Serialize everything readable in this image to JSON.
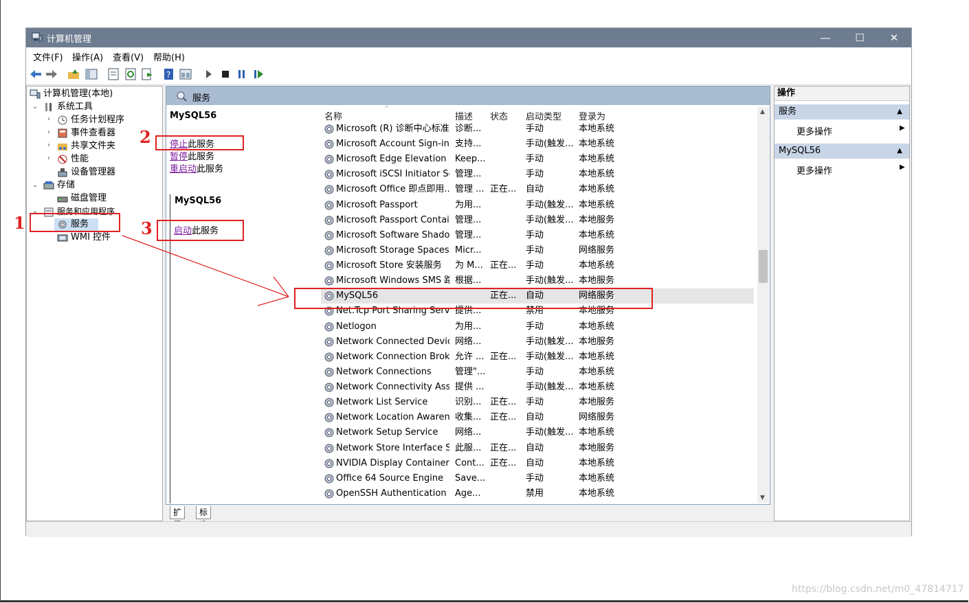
{
  "window": {
    "title": "计算机管理",
    "controls": [
      "—",
      "☐",
      "✕"
    ]
  },
  "menu": [
    "文件(F)",
    "操作(A)",
    "查看(V)",
    "帮助(H)"
  ],
  "tree": {
    "root": "计算机管理(本地)",
    "system_tools": "系统工具",
    "task_scheduler": "任务计划程序",
    "event_viewer": "事件查看器",
    "shared_folders": "共享文件夹",
    "performance": "性能",
    "device_manager": "设备管理器",
    "storage": "存储",
    "disk_management": "磁盘管理",
    "services_apps": "服务和应用程序",
    "services": "服务",
    "wmi": "WMI 控件"
  },
  "center": {
    "header": "服务",
    "selected_name": "MySQL56",
    "actions": {
      "stop_link": "停止",
      "stop_rest": "此服务",
      "pause_link": "暂停",
      "pause_rest": "此服务",
      "restart_link": "重启动",
      "restart_rest": "此服务"
    },
    "overlay_name": "MySQL56",
    "start_link": "启动",
    "start_rest": "此服务"
  },
  "columns": {
    "name": "名称",
    "desc": "描述",
    "status": "状态",
    "startup": "启动类型",
    "logon": "登录为"
  },
  "rows": [
    {
      "name": "Microsoft (R) 诊断中心标准...",
      "desc": "诊断...",
      "status": "",
      "startup": "手动",
      "logon": "本地系统"
    },
    {
      "name": "Microsoft Account Sign-in ...",
      "desc": "支持...",
      "status": "",
      "startup": "手动(触发...",
      "logon": "本地系统"
    },
    {
      "name": "Microsoft Edge Elevation S...",
      "desc": "Keep...",
      "status": "",
      "startup": "手动",
      "logon": "本地系统"
    },
    {
      "name": "Microsoft iSCSI Initiator Ser...",
      "desc": "管理...",
      "status": "",
      "startup": "手动",
      "logon": "本地系统"
    },
    {
      "name": "Microsoft Office 即点即用...",
      "desc": "管理 ...",
      "status": "正在...",
      "startup": "自动",
      "logon": "本地系统"
    },
    {
      "name": "Microsoft Passport",
      "desc": "为用...",
      "status": "",
      "startup": "手动(触发...",
      "logon": "本地系统"
    },
    {
      "name": "Microsoft Passport Container",
      "desc": "管理...",
      "status": "",
      "startup": "手动(触发...",
      "logon": "本地服务"
    },
    {
      "name": "Microsoft Software Shado...",
      "desc": "管理...",
      "status": "",
      "startup": "手动",
      "logon": "本地系统"
    },
    {
      "name": "Microsoft Storage Spaces S...",
      "desc": "Micr...",
      "status": "",
      "startup": "手动",
      "logon": "网络服务"
    },
    {
      "name": "Microsoft Store 安装服务",
      "desc": "为 M...",
      "status": "正在...",
      "startup": "手动",
      "logon": "本地系统"
    },
    {
      "name": "Microsoft Windows SMS 路...",
      "desc": "根据...",
      "status": "",
      "startup": "手动(触发...",
      "logon": "本地服务"
    },
    {
      "name": "MySQL56",
      "desc": "",
      "status": "正在...",
      "startup": "自动",
      "logon": "网络服务"
    },
    {
      "name": "Net.Tcp Port Sharing Service",
      "desc": "提供...",
      "status": "",
      "startup": "禁用",
      "logon": "本地服务"
    },
    {
      "name": "Netlogon",
      "desc": "为用...",
      "status": "",
      "startup": "手动",
      "logon": "本地系统"
    },
    {
      "name": "Network Connected Devic...",
      "desc": "网络...",
      "status": "",
      "startup": "手动(触发...",
      "logon": "本地服务"
    },
    {
      "name": "Network Connection Broker",
      "desc": "允许 ...",
      "status": "正在...",
      "startup": "手动(触发...",
      "logon": "本地系统"
    },
    {
      "name": "Network Connections",
      "desc": "管理\"...",
      "status": "",
      "startup": "手动",
      "logon": "本地系统"
    },
    {
      "name": "Network Connectivity Assis...",
      "desc": "提供 ...",
      "status": "",
      "startup": "手动(触发...",
      "logon": "本地系统"
    },
    {
      "name": "Network List Service",
      "desc": "识别...",
      "status": "正在...",
      "startup": "手动",
      "logon": "本地服务"
    },
    {
      "name": "Network Location Awarene...",
      "desc": "收集...",
      "status": "正在...",
      "startup": "自动",
      "logon": "网络服务"
    },
    {
      "name": "Network Setup Service",
      "desc": "网络...",
      "status": "",
      "startup": "手动(触发...",
      "logon": "本地系统"
    },
    {
      "name": "Network Store Interface Se...",
      "desc": "此服...",
      "status": "正在...",
      "startup": "自动",
      "logon": "本地服务"
    },
    {
      "name": "NVIDIA Display Container LS",
      "desc": "Cont...",
      "status": "正在...",
      "startup": "自动",
      "logon": "本地系统"
    },
    {
      "name": "Office 64 Source Engine",
      "desc": "Save...",
      "status": "",
      "startup": "手动",
      "logon": "本地系统"
    },
    {
      "name": "OpenSSH Authentication ...",
      "desc": "Age...",
      "status": "",
      "startup": "禁用",
      "logon": "本地系统"
    }
  ],
  "tabs": [
    "扩展",
    "标准"
  ],
  "actions_pane": {
    "title": "操作",
    "section1": "服务",
    "more1": "更多操作",
    "section2": "MySQL56",
    "more2": "更多操作"
  },
  "annotations": {
    "one": "1",
    "two": "2",
    "three": "3"
  },
  "watermark": "https://blog.csdn.net/m0_47814717",
  "colors": {
    "annotation": "#e02020",
    "titlebar": "#6d7c8f",
    "link": "#7a1aa0",
    "header": "#aabcd2"
  }
}
